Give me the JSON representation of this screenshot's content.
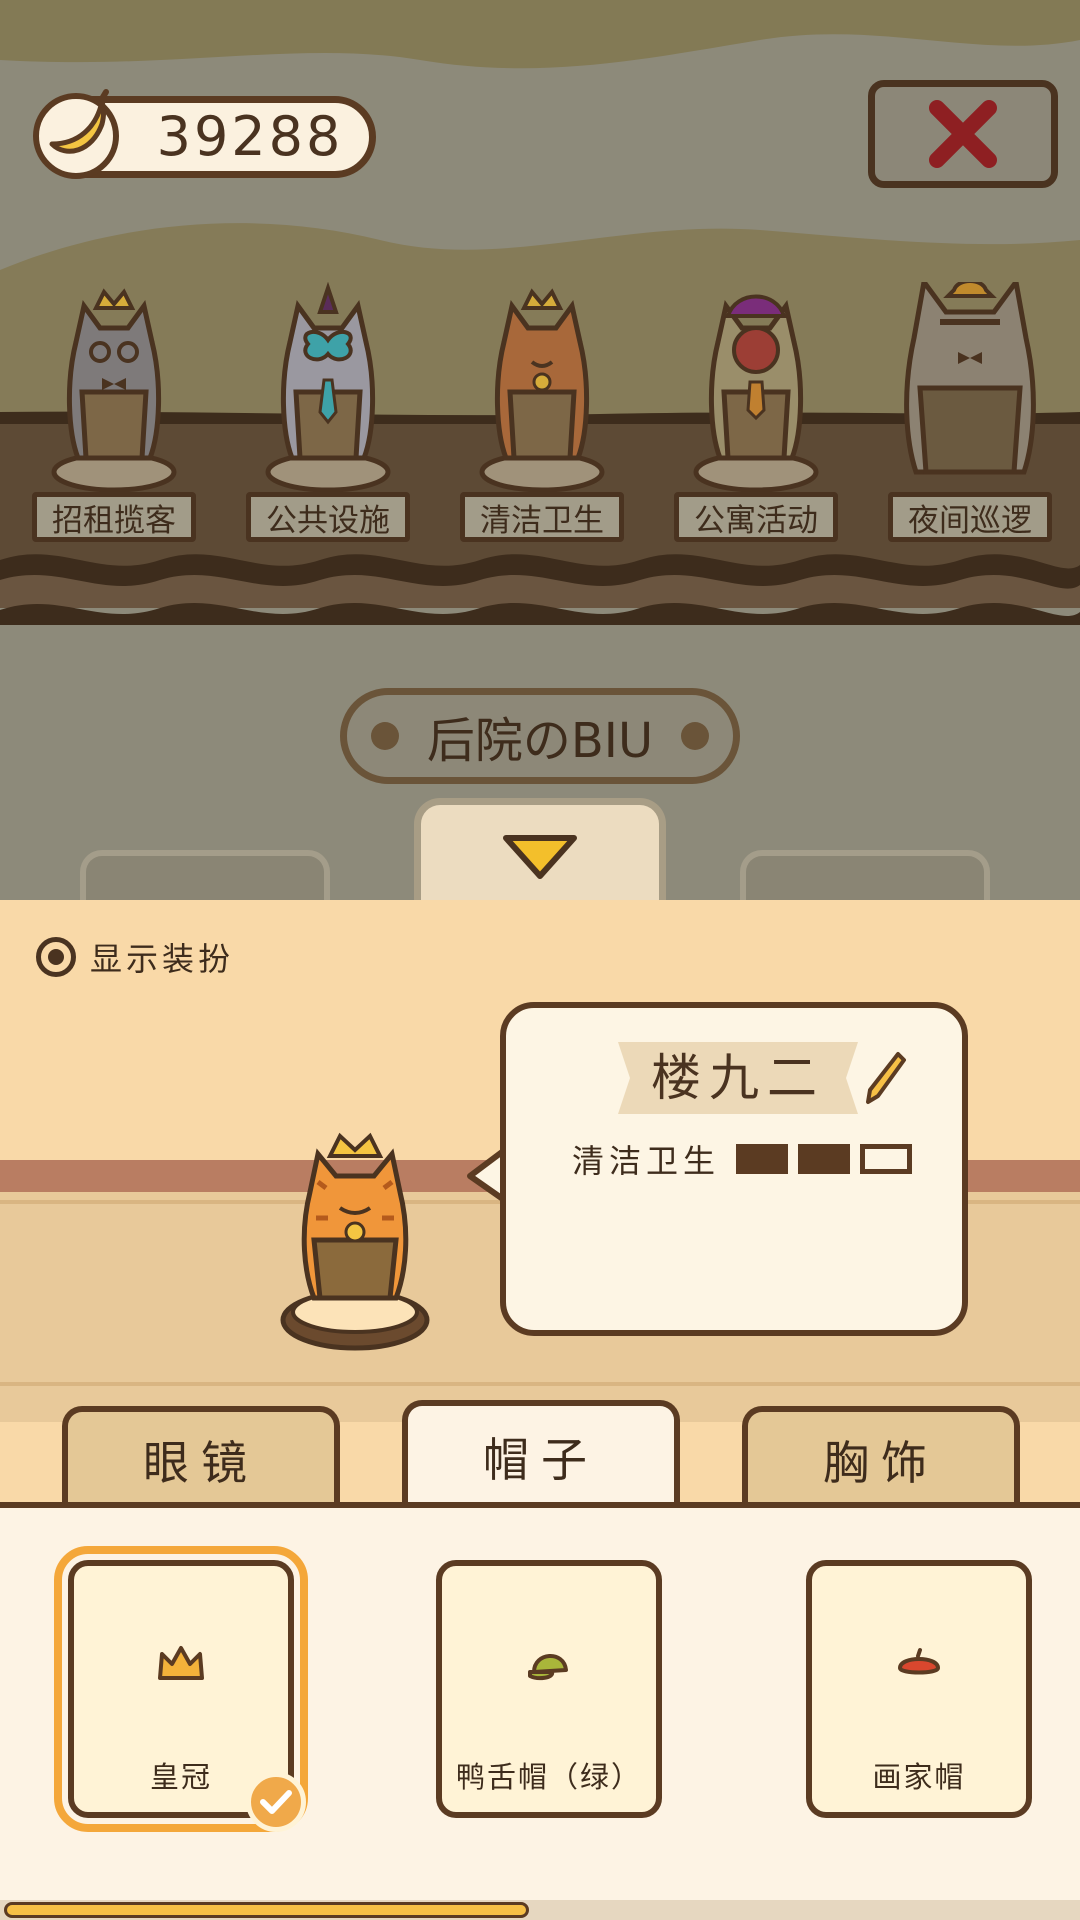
{
  "currency": {
    "value": "39288",
    "icon": "banana-icon"
  },
  "close": {
    "icon": "close-x-icon",
    "color": "#8e1f22"
  },
  "departments": [
    {
      "label": "招租揽客"
    },
    {
      "label": "公共设施"
    },
    {
      "label": "清洁卫生"
    },
    {
      "label": "公寓活动"
    },
    {
      "label": "夜间巡逻"
    }
  ],
  "building_tag": {
    "label": "后院のBIU"
  },
  "panel": {
    "show_costume_label": "显示装扮",
    "character": {
      "name": "楼九二",
      "skill_label": "清洁卫生",
      "skill_level": 2,
      "skill_max": 3
    },
    "tabs": [
      {
        "label": "眼镜"
      },
      {
        "label": "帽子"
      },
      {
        "label": "胸饰"
      }
    ],
    "active_tab": "帽子",
    "items": [
      {
        "label": "皇冠",
        "icon": "crown-icon",
        "selected": true
      },
      {
        "label": "鸭舌帽（绿）",
        "icon": "green-cap-icon",
        "selected": false
      },
      {
        "label": "画家帽",
        "icon": "beret-icon",
        "selected": false
      }
    ]
  },
  "colors": {
    "accent": "#f4a73a",
    "outline": "#5b3b22",
    "panel_bg": "#f9d9a8"
  },
  "scroll_progress": 0.49
}
